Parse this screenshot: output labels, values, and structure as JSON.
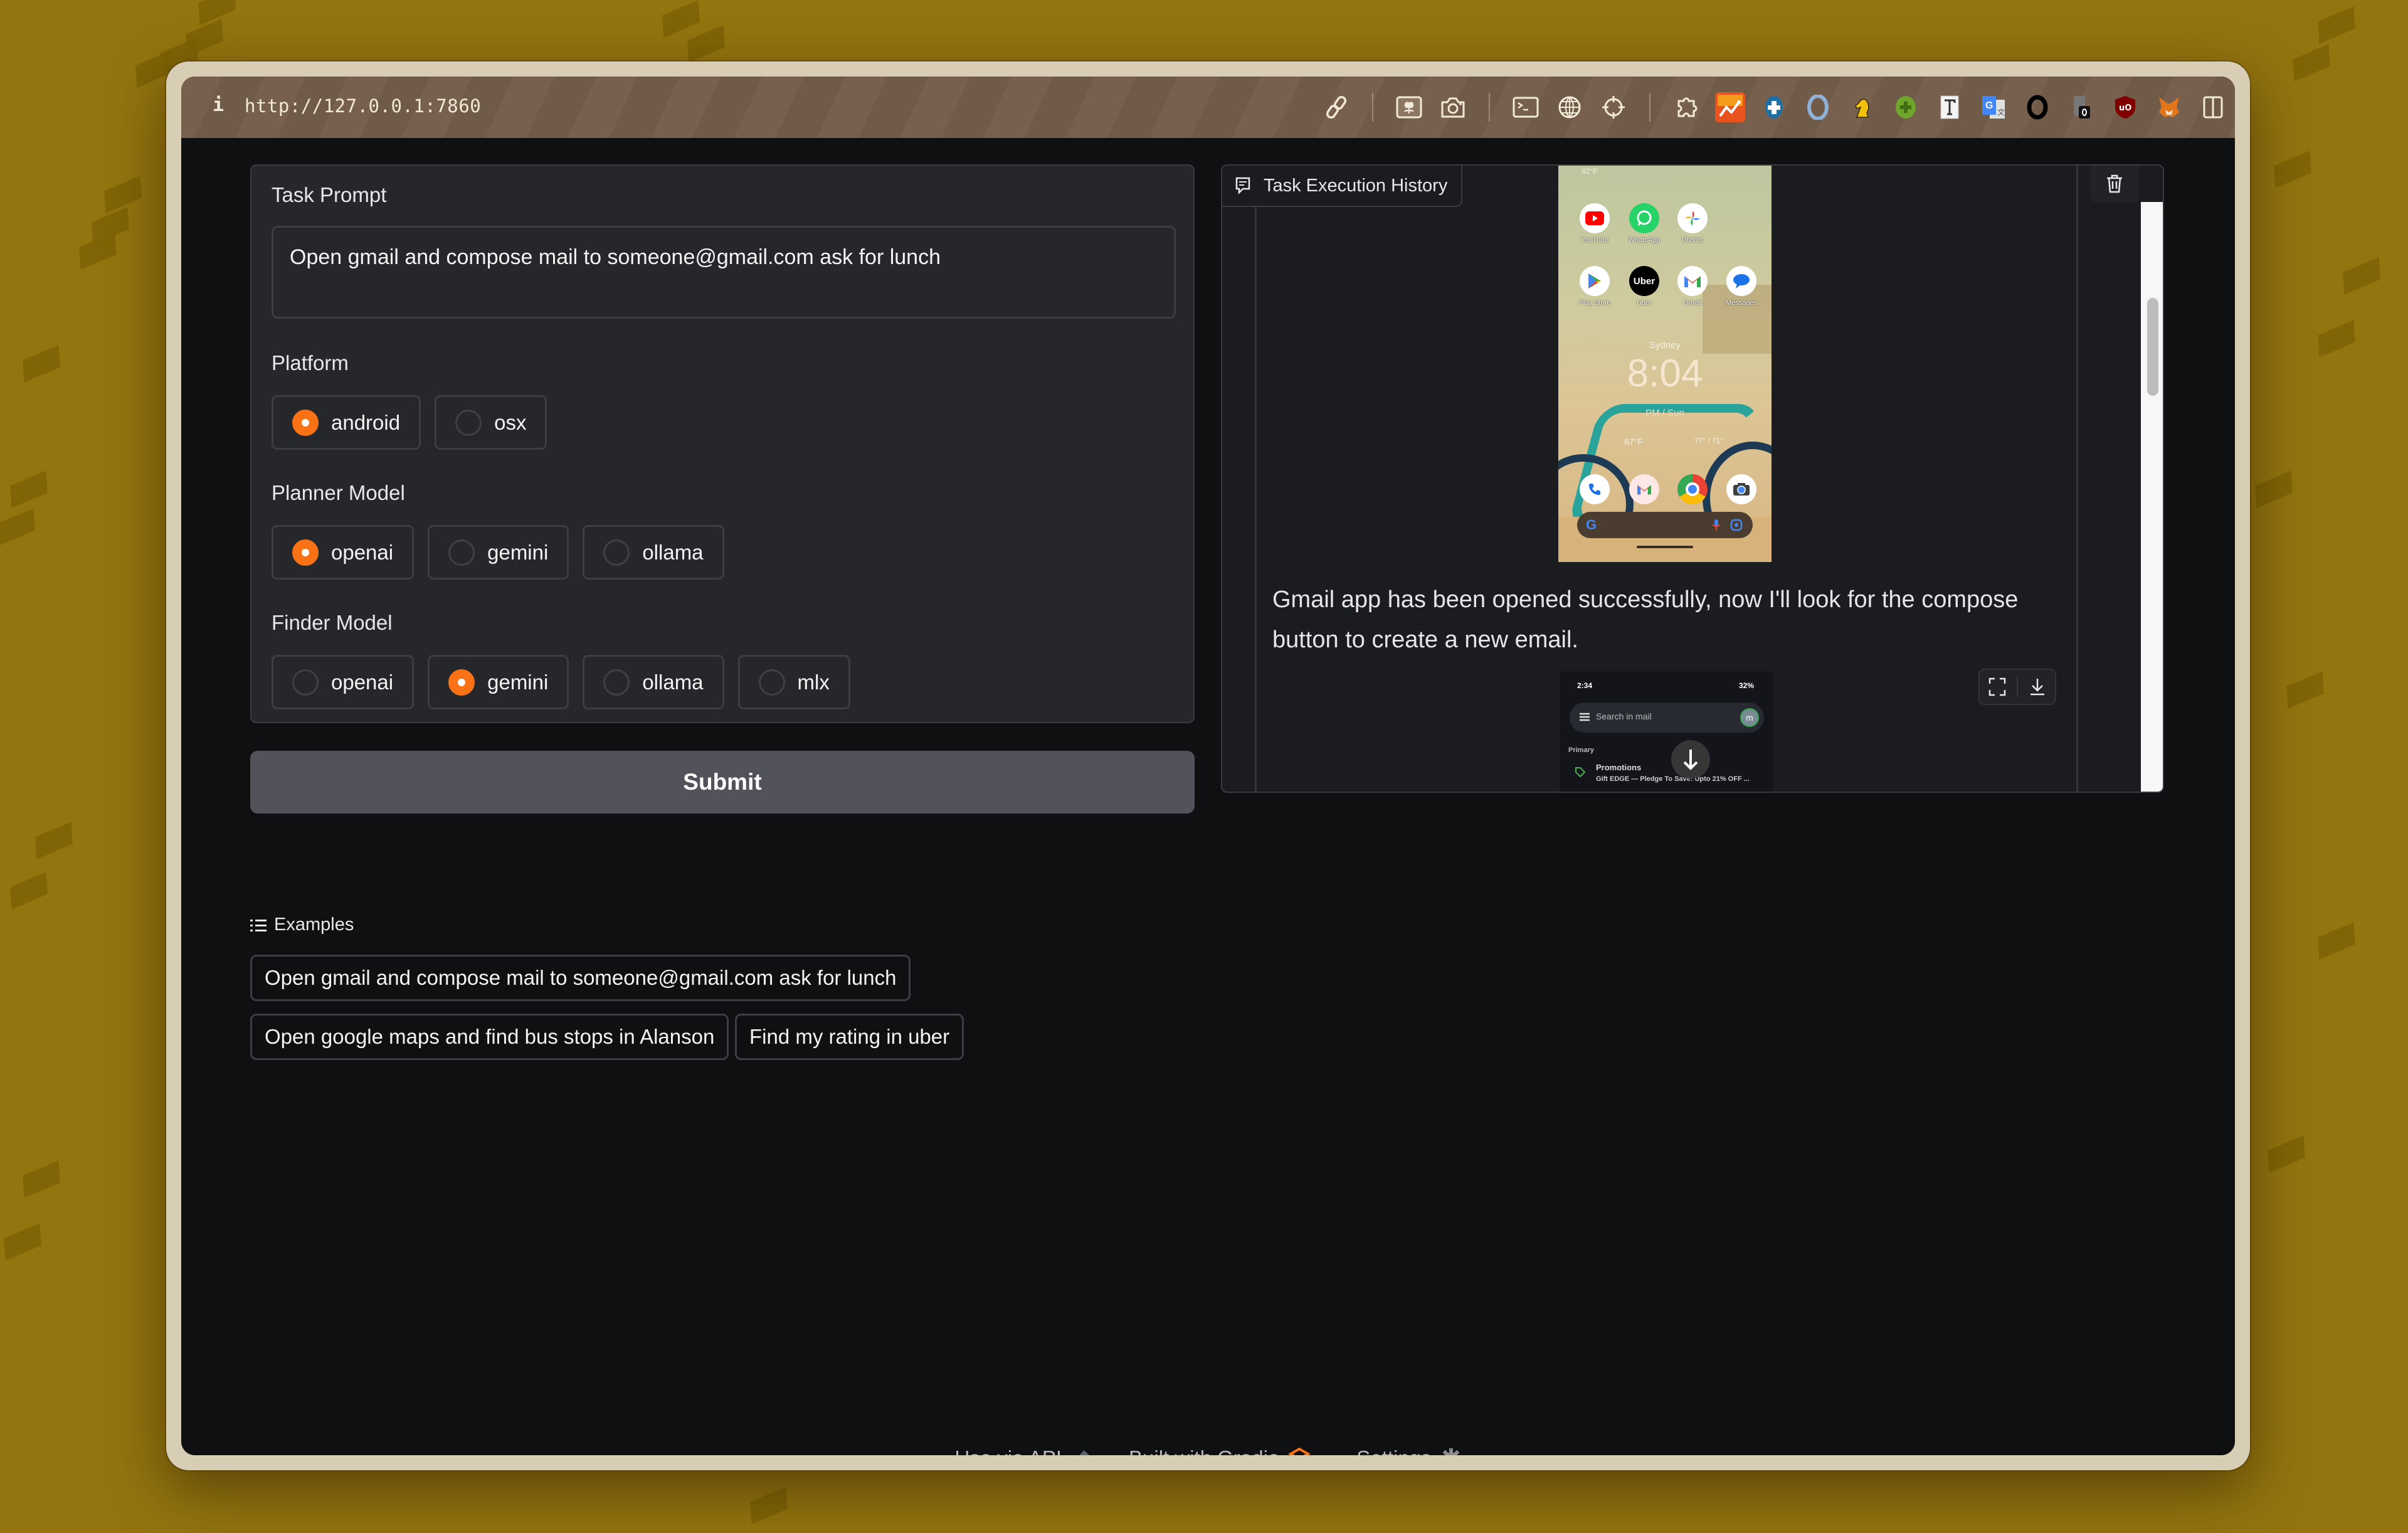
{
  "browser": {
    "info_icon": "i",
    "url": "http://127.0.0.1:7860",
    "toolbar_icons": [
      "link-icon",
      "image-screenshot-icon",
      "camera-icon",
      "terminal-icon",
      "globe-icon",
      "crosshair-icon",
      "puzzle-extensions-icon",
      "analytics-extension-icon",
      "blue-cross-extension-icon",
      "ring-extension-icon",
      "chess-knight-extension-icon",
      "green-plus-extension-icon",
      "text-T-extension-icon",
      "google-translate-icon",
      "black-ring-extension-icon",
      "phone-extension-icon",
      "ublock-origin-icon",
      "metamask-fox-icon",
      "sidebar-toggle-icon"
    ]
  },
  "form": {
    "task_prompt": {
      "label": "Task Prompt",
      "value": "Open gmail and compose mail to someone@gmail.com ask for lunch"
    },
    "platform": {
      "label": "Platform",
      "options": [
        "android",
        "osx"
      ],
      "selected": "android"
    },
    "planner_model": {
      "label": "Planner Model",
      "options": [
        "openai",
        "gemini",
        "ollama"
      ],
      "selected": "openai"
    },
    "finder_model": {
      "label": "Finder Model",
      "options": [
        "openai",
        "gemini",
        "ollama",
        "mlx"
      ],
      "selected": "gemini"
    },
    "submit_label": "Submit"
  },
  "examples": {
    "header": "Examples",
    "items": [
      "Open gmail and compose mail to someone@gmail.com ask for lunch",
      "Open google maps and find bus stops in Alanson",
      "Find my rating in uber"
    ]
  },
  "chat": {
    "label": "Task Execution History",
    "phone_home": {
      "weather_top": "82°F",
      "apps_row1": [
        "YouTube",
        "WhatsApp",
        "Photos"
      ],
      "apps_row2": [
        "Play Store",
        "Uber",
        "Gmail",
        "Messages"
      ],
      "city": "Sydney",
      "time": "8:04",
      "day": "PM / Sun",
      "weather_bottom": "67°F",
      "temp_range": "77° / 71°",
      "dock": [
        "Phone",
        "Gmail",
        "Chrome",
        "Camera"
      ]
    },
    "message": "Gmail app has been opened successfully, now I'll look for the compose button to create a new email.",
    "phone_gmail": {
      "status_time": "2:34",
      "battery": "32%",
      "search_placeholder": "Search in mail",
      "avatar_letter": "m",
      "section": "Primary",
      "item_title": "Promotions",
      "item_snippet": "Gift EDGE — Pledge To Save: Upto 21% OFF ..."
    }
  },
  "footer": {
    "api": "Use via API",
    "built": "Built with Gradio",
    "settings": "Settings",
    "separator": "·"
  },
  "colors": {
    "accent": "#f97316",
    "submit_bg": "#52525b",
    "panel_bg": "#26272b",
    "page_bg": "#0f1012"
  }
}
